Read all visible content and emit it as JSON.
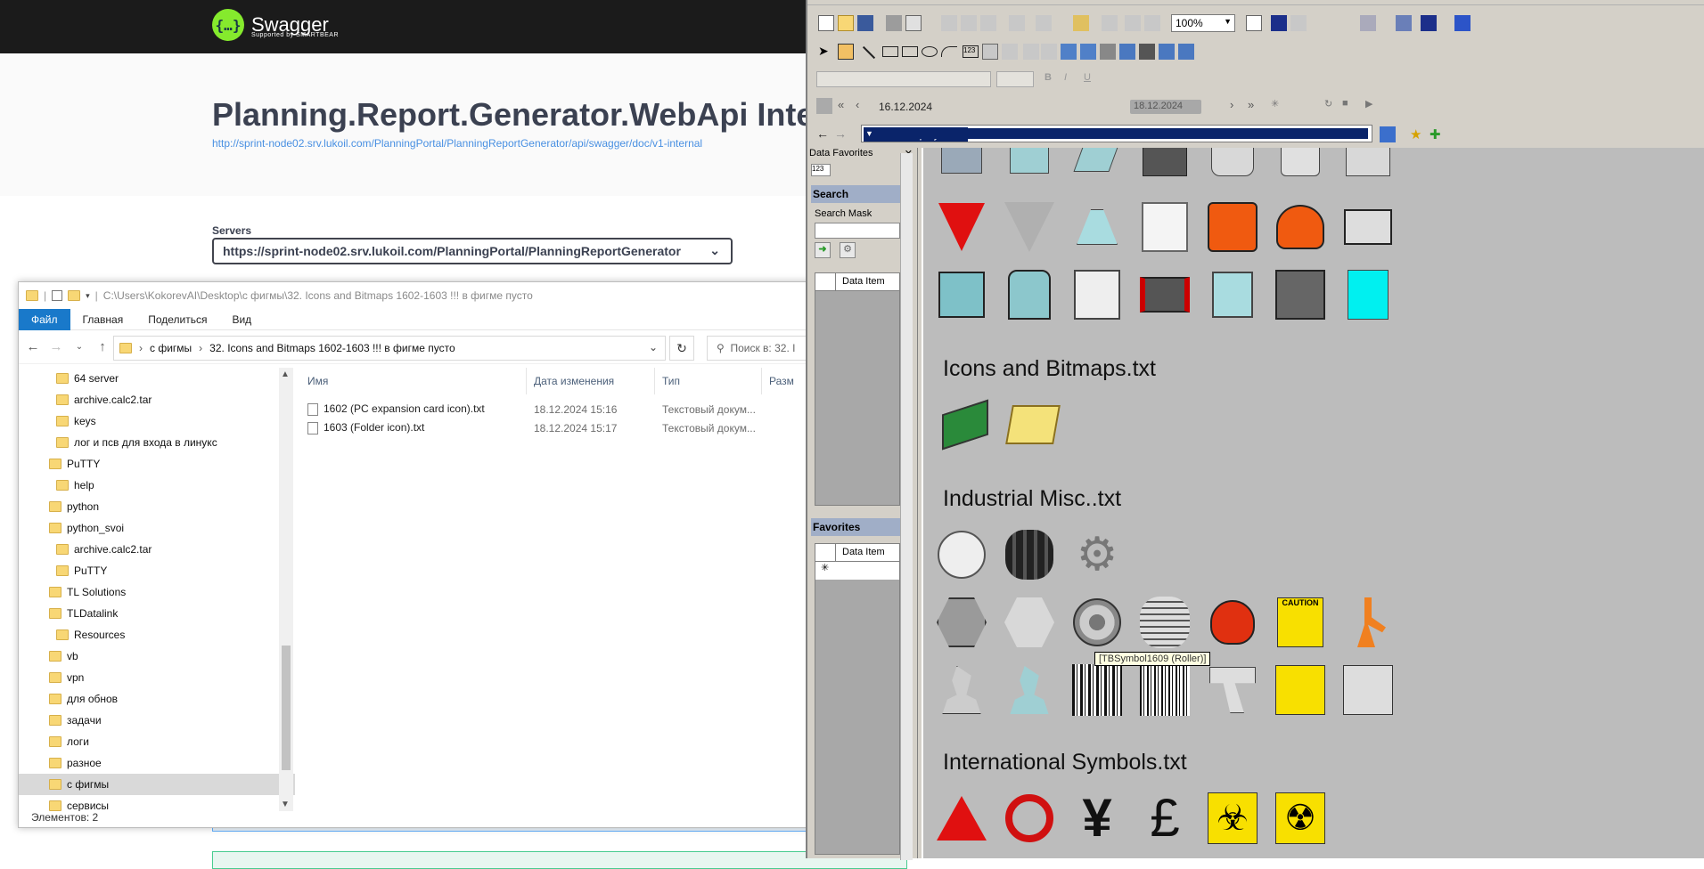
{
  "swagger": {
    "brand": "Swagger",
    "brand_sub": "Supported by SMARTBEAR",
    "title": "Planning.Report.Generator.WebApi Internal",
    "spec_url": "http://sprint-node02.srv.lukoil.com/PlanningPortal/PlanningReportGenerator/api/swagger/doc/v1-internal",
    "servers_label": "Servers",
    "server_value": "https://sprint-node02.srv.lukoil.com/PlanningPortal/PlanningReportGenerator"
  },
  "explorer": {
    "title_path": "C:\\Users\\KokorevAI\\Desktop\\с фигмы\\32. Icons and Bitmaps 1602-1603 !!! в фигме пусто",
    "ribbon": [
      "Файл",
      "Главная",
      "Поделиться",
      "Вид"
    ],
    "breadcrumb": [
      "с фигмы",
      "32. Icons and Bitmaps 1602-1603 !!! в фигме пусто"
    ],
    "search_placeholder": "Поиск в: 32. I",
    "tree": [
      {
        "label": "64 server",
        "level": 2
      },
      {
        "label": "archive.calc2.tar",
        "level": 2
      },
      {
        "label": "keys",
        "level": 2
      },
      {
        "label": "лог и псв для входа в линукс",
        "level": 2
      },
      {
        "label": "PuTTY",
        "level": 1
      },
      {
        "label": "help",
        "level": 2
      },
      {
        "label": "python",
        "level": 1
      },
      {
        "label": "python_svoi",
        "level": 1
      },
      {
        "label": "archive.calc2.tar",
        "level": 2
      },
      {
        "label": "PuTTY",
        "level": 2
      },
      {
        "label": "TL Solutions",
        "level": 1
      },
      {
        "label": "TLDatalink",
        "level": 1
      },
      {
        "label": "Resources",
        "level": 2
      },
      {
        "label": "vb",
        "level": 1
      },
      {
        "label": "vpn",
        "level": 1
      },
      {
        "label": "для обнов",
        "level": 1
      },
      {
        "label": "задачи",
        "level": 1
      },
      {
        "label": "логи",
        "level": 1
      },
      {
        "label": "разное",
        "level": 1
      },
      {
        "label": "с фигмы",
        "level": 1,
        "selected": true
      },
      {
        "label": "сервисы",
        "level": 1
      }
    ],
    "columns": [
      "Имя",
      "Дата изменения",
      "Тип",
      "Разм"
    ],
    "files": [
      {
        "name": "1602 (PC expansion card icon).txt",
        "date": "18.12.2024 15:16",
        "type": "Текстовый докум..."
      },
      {
        "name": "1603 (Folder icon).txt",
        "date": "18.12.2024 15:17",
        "type": "Текстовый докум..."
      }
    ],
    "status": "Элементов: 2"
  },
  "app": {
    "zoom": "100%",
    "date_from": "16.12.2024",
    "date_to": "18.12.2024",
    "path": "D:\\Distr\\Display2.PDI",
    "sidebar_title": "Data Favorites",
    "search_header": "Search",
    "search_mask_label": "Search Mask",
    "data_item_col": "Data Item",
    "favorites_header": "Favorites",
    "categories": [
      "Icons and Bitmaps.txt",
      "Industrial Misc..txt",
      "International Symbols.txt"
    ],
    "tooltip": "[TBSymbol1609 (Roller)]",
    "caution_label": "CAUTION"
  }
}
